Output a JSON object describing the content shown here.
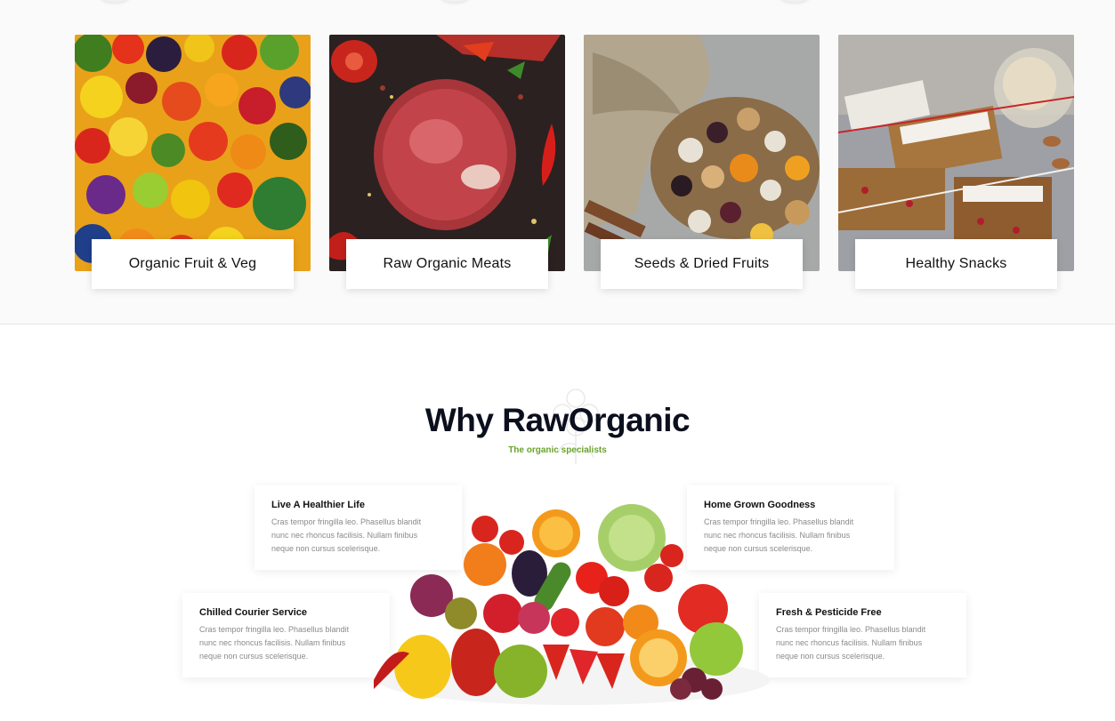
{
  "categories": [
    {
      "label": "Organic Fruit & Veg",
      "image": "fruit-veg-photo"
    },
    {
      "label": "Raw Organic Meats",
      "image": "raw-meat-photo"
    },
    {
      "label": "Seeds & Dried Fruits",
      "image": "seeds-nuts-photo"
    },
    {
      "label": "Healthy Snacks",
      "image": "snack-bars-photo"
    }
  ],
  "why": {
    "title": "Why RawOrganic",
    "subtitle": "The organic specialists"
  },
  "features": [
    {
      "title": "Live A Healthier Life",
      "body": "Cras tempor fringilla leo. Phasellus blandit nunc nec rhoncus facilisis. Nullam finibus neque non cursus scelerisque."
    },
    {
      "title": "Home Grown Goodness",
      "body": "Cras tempor fringilla leo. Phasellus blandit nunc nec rhoncus facilisis. Nullam finibus neque non cursus scelerisque."
    },
    {
      "title": "Chilled Courier Service",
      "body": "Cras tempor fringilla leo. Phasellus blandit nunc nec rhoncus facilisis. Nullam finibus neque non cursus scelerisque."
    },
    {
      "title": "Fresh & Pesticide Free",
      "body": "Cras tempor fringilla leo. Phasellus blandit nunc nec rhoncus facilisis. Nullam finibus neque non cursus scelerisque."
    }
  ],
  "colors": {
    "accent": "#6aa32c",
    "title": "#0b0f1e",
    "body_text": "#8a8a8a"
  },
  "icons": {
    "watermark": "leaf-ornament-icon"
  }
}
